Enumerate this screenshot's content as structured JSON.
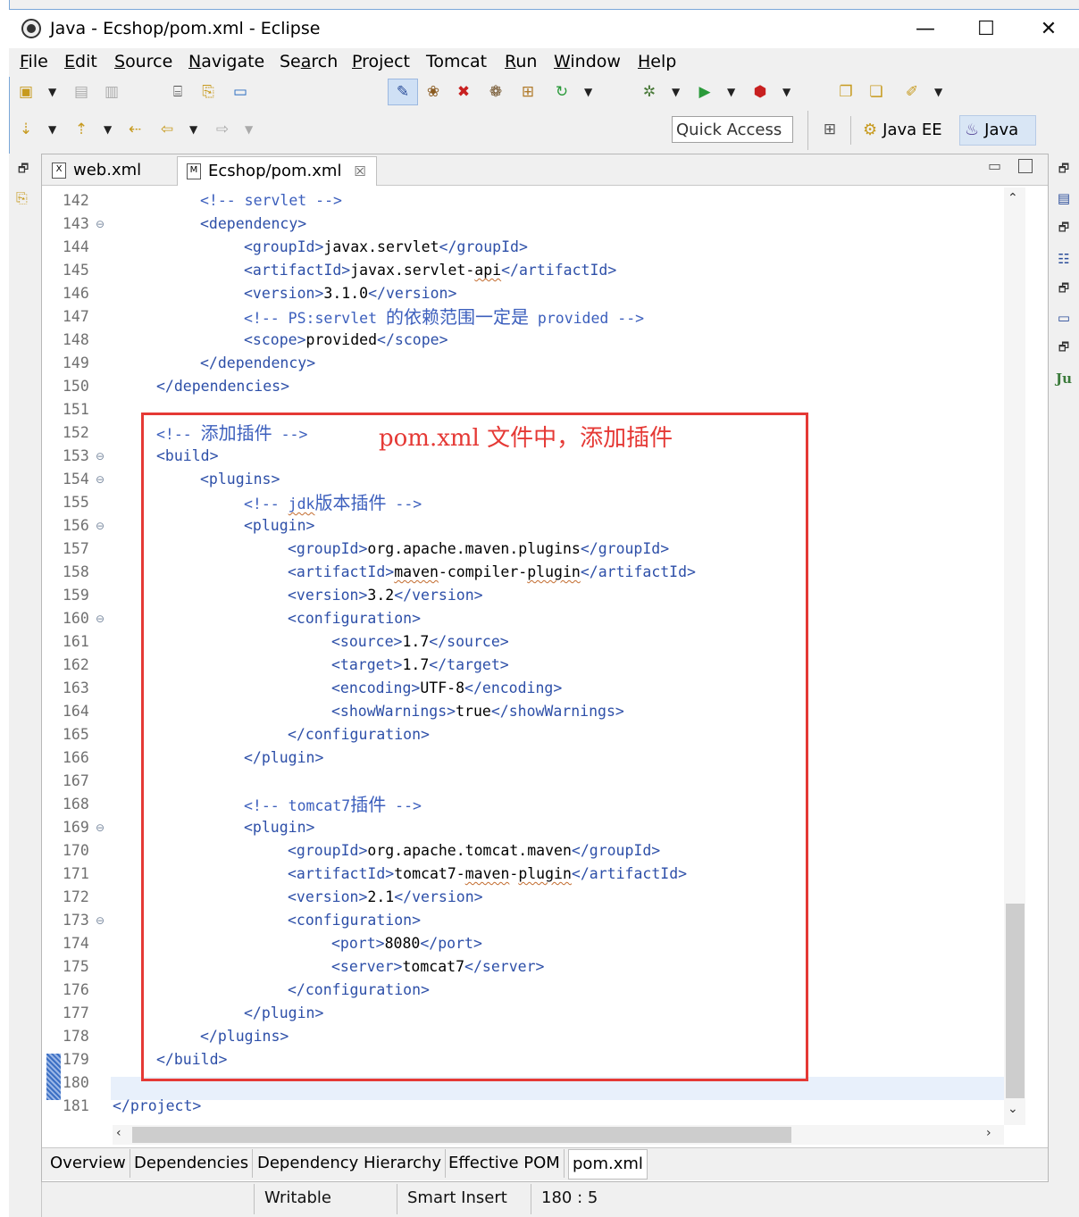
{
  "window": {
    "title": "Java - Ecshop/pom.xml - Eclipse",
    "minimize": "—",
    "maximize": "☐",
    "close": "✕"
  },
  "menu": [
    {
      "label": "File",
      "mnemonic": "F",
      "rest": "ile"
    },
    {
      "label": "Edit",
      "mnemonic": "E",
      "rest": "dit"
    },
    {
      "label": "Source",
      "mnemonic": "S",
      "rest": "ource"
    },
    {
      "label": "Navigate",
      "mnemonic": "N",
      "rest": "avigate"
    },
    {
      "label": "Search",
      "mnemonic": "a",
      "pre": "Se",
      "rest": "rch"
    },
    {
      "label": "Project",
      "mnemonic": "P",
      "rest": "roject"
    },
    {
      "label": "Tomcat",
      "plain": "Tomcat"
    },
    {
      "label": "Run",
      "mnemonic": "R",
      "rest": "un"
    },
    {
      "label": "Window",
      "mnemonic": "W",
      "rest": "indow"
    },
    {
      "label": "Help",
      "mnemonic": "H",
      "rest": "elp"
    }
  ],
  "toolbar": {
    "quick_access": "Quick Access",
    "perspective_javaee": "Java EE",
    "perspective_java": "Java"
  },
  "editor_tabs": [
    {
      "label": "web.xml",
      "icon": "X"
    },
    {
      "label": "Ecshop/pom.xml",
      "icon": "M",
      "close": "☒"
    }
  ],
  "code_lines": [
    {
      "n": "142",
      "fold": false
    },
    {
      "n": "143",
      "fold": true
    },
    {
      "n": "144",
      "fold": false
    },
    {
      "n": "145",
      "fold": false
    },
    {
      "n": "146",
      "fold": false
    },
    {
      "n": "147",
      "fold": false
    },
    {
      "n": "148",
      "fold": false
    },
    {
      "n": "149",
      "fold": false
    },
    {
      "n": "150",
      "fold": false
    },
    {
      "n": "151",
      "fold": false
    },
    {
      "n": "152",
      "fold": false
    },
    {
      "n": "153",
      "fold": true
    },
    {
      "n": "154",
      "fold": true
    },
    {
      "n": "155",
      "fold": false
    },
    {
      "n": "156",
      "fold": true
    },
    {
      "n": "157",
      "fold": false
    },
    {
      "n": "158",
      "fold": false
    },
    {
      "n": "159",
      "fold": false
    },
    {
      "n": "160",
      "fold": true
    },
    {
      "n": "161",
      "fold": false
    },
    {
      "n": "162",
      "fold": false
    },
    {
      "n": "163",
      "fold": false
    },
    {
      "n": "164",
      "fold": false
    },
    {
      "n": "165",
      "fold": false
    },
    {
      "n": "166",
      "fold": false
    },
    {
      "n": "167",
      "fold": false
    },
    {
      "n": "168",
      "fold": false
    },
    {
      "n": "169",
      "fold": true
    },
    {
      "n": "170",
      "fold": false
    },
    {
      "n": "171",
      "fold": false
    },
    {
      "n": "172",
      "fold": false
    },
    {
      "n": "173",
      "fold": true
    },
    {
      "n": "174",
      "fold": false
    },
    {
      "n": "175",
      "fold": false
    },
    {
      "n": "176",
      "fold": false
    },
    {
      "n": "177",
      "fold": false
    },
    {
      "n": "178",
      "fold": false
    },
    {
      "n": "179",
      "fold": false
    },
    {
      "n": "180",
      "fold": false
    },
    {
      "n": "181",
      "fold": false
    }
  ],
  "code": {
    "l142": "<!-- servlet -->",
    "l143": "<dependency>",
    "l144_open": "<groupId>",
    "l144_val": "javax.servlet",
    "l144_close": "</groupId>",
    "l145_open": "<artifactId>",
    "l145_val1": "javax.servlet-",
    "l145_val2": "api",
    "l145_close": "</artifactId>",
    "l146_open": "<version>",
    "l146_val": "3.1.0",
    "l146_close": "</version>",
    "l147_a": "<!-- PS:servlet ",
    "l147_cjk": "的依赖范围一定是",
    "l147_b": " provided -->",
    "l148_open": "<scope>",
    "l148_val": "provided",
    "l148_close": "</scope>",
    "l149": "</dependency>",
    "l150": "</dependencies>",
    "l152_a": "<!-- ",
    "l152_cjk": "添加插件",
    "l152_b": " -->",
    "l153": "<build>",
    "l154": "<plugins>",
    "l155_a": "<!-- ",
    "l155_jdk": "jdk",
    "l155_cjk": "版本插件",
    "l155_b": " -->",
    "l156": "<plugin>",
    "l157_open": "<groupId>",
    "l157_val": "org.apache.maven.plugins",
    "l157_close": "</groupId>",
    "l158_open": "<artifactId>",
    "l158_v1": "maven",
    "l158_v2": "-compiler-",
    "l158_v3": "plugin",
    "l158_close": "</artifactId>",
    "l159_open": "<version>",
    "l159_val": "3.2",
    "l159_close": "</version>",
    "l160": "<configuration>",
    "l161_open": "<source>",
    "l161_val": "1.7",
    "l161_close": "</source>",
    "l162_open": "<target>",
    "l162_val": "1.7",
    "l162_close": "</target>",
    "l163_open": "<encoding>",
    "l163_val": "UTF-8",
    "l163_close": "</encoding>",
    "l164_open": "<showWarnings>",
    "l164_val": "true",
    "l164_close": "</showWarnings>",
    "l165": "</configuration>",
    "l166": "</plugin>",
    "l168_a": "<!-- tomcat7",
    "l168_cjk": "插件",
    "l168_b": " -->",
    "l169": "<plugin>",
    "l170_open": "<groupId>",
    "l170_val": "org.apache.tomcat.maven",
    "l170_close": "</groupId>",
    "l171_open": "<artifactId>",
    "l171_v1": "tomcat7-",
    "l171_v2": "maven",
    "l171_v3": "-",
    "l171_v4": "plugin",
    "l171_close": "</artifactId>",
    "l172_open": "<version>",
    "l172_val": "2.1",
    "l172_close": "</version>",
    "l173": "<configuration>",
    "l174_open": "<port>",
    "l174_val": "8080",
    "l174_close": "</port>",
    "l175_open": "<server>",
    "l175_val": "tomcat7",
    "l175_close": "</server>",
    "l176": "</configuration>",
    "l177": "</plugin>",
    "l178": "</plugins>",
    "l179": "</build>",
    "l181": "</project>"
  },
  "annotation": "pom.xml  文件中，添加插件",
  "bottom_tabs": [
    "Overview",
    "Dependencies",
    "Dependency Hierarchy",
    "Effective POM",
    "pom.xml"
  ],
  "status": {
    "writable": "Writable",
    "insert_mode": "Smart Insert",
    "position": "180 : 5"
  },
  "colors": {
    "tag": "#2d4fa8",
    "comment": "#3c5fbd",
    "annotation_red": "#e53935",
    "current_line": "#e8f0fb"
  }
}
